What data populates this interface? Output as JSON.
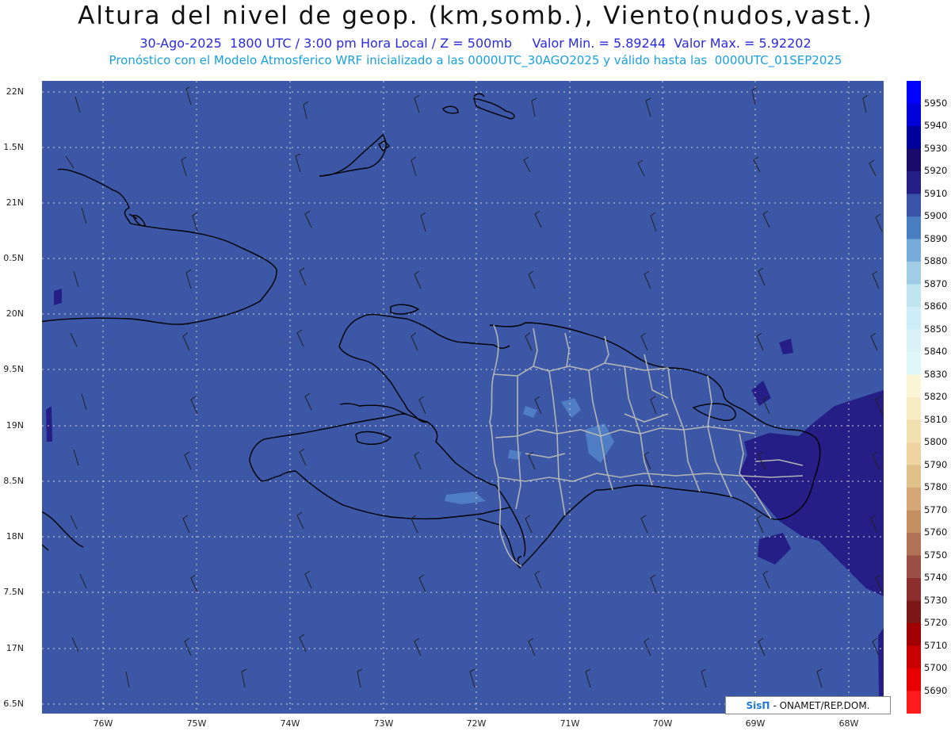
{
  "header": {
    "title": "Altura del nivel de geop. (km,somb.), Viento(nudos,vast.)",
    "subtitle1": "30-Ago-2025  1800 UTC / 3:00 pm Hora Local / Z = 500mb     Valor Min. = 5.89244  Valor Max. = 5.92202",
    "subtitle2": "Pronóstico con el Modelo Atmosferico WRF inicializado a las 0000UTC_30AGO2025 y válido hasta las  0000UTC_01SEP2025"
  },
  "axes": {
    "lat_labels": [
      "22N",
      "1.5N",
      "21N",
      "0.5N",
      "20N",
      "9.5N",
      "19N",
      "8.5N",
      "18N",
      "7.5N",
      "17N",
      "6.5N"
    ],
    "lon_labels": [
      "76W",
      "75W",
      "74W",
      "73W",
      "72W",
      "71W",
      "70W",
      "69W",
      "68W"
    ]
  },
  "colorbar": {
    "labels": [
      "5950",
      "5940",
      "5930",
      "5920",
      "5910",
      "5900",
      "5890",
      "5880",
      "5870",
      "5860",
      "5850",
      "5840",
      "5830",
      "5820",
      "5810",
      "5800",
      "5790",
      "5780",
      "5770",
      "5760",
      "5750",
      "5740",
      "5730",
      "5720",
      "5710",
      "5700",
      "5690"
    ],
    "colors": [
      "#0000ff",
      "#0000d8",
      "#00009a",
      "#1a0a6a",
      "#241e86",
      "#3a55a8",
      "#4a7ec0",
      "#78acd8",
      "#a0cce6",
      "#bfe6f0",
      "#cdeef6",
      "#d9f3f9",
      "#e0f7fa",
      "#fdf6d6",
      "#f8ecc4",
      "#f3e0b0",
      "#eed4a0",
      "#e2c08a",
      "#d4a876",
      "#c49062",
      "#b07254",
      "#9a5044",
      "#8c2e30",
      "#7c1818",
      "#a00000",
      "#c80000",
      "#e60000",
      "#ff1c1c"
    ]
  },
  "field": {
    "background": "#3b57a6",
    "high_color": "#241e86",
    "low_color": "#4f7ec4",
    "coast_color": "#000000",
    "border_color": "#b4b4b4"
  },
  "credit": {
    "brand": "SisΠ",
    "text": "- ONAMET/REP.DOM."
  }
}
